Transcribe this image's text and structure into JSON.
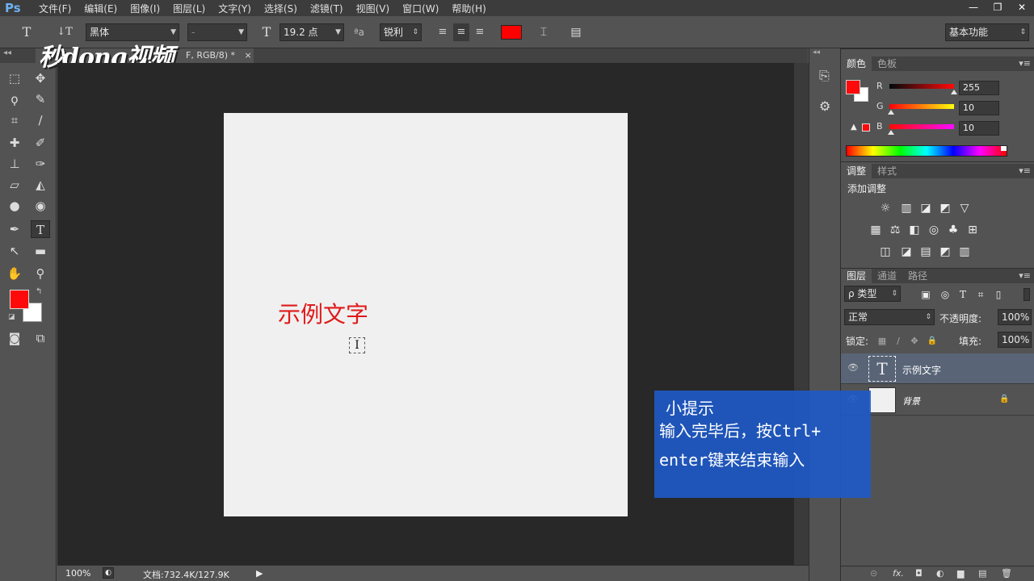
{
  "menubar": {
    "logo": "Ps",
    "items": [
      "文件(F)",
      "编辑(E)",
      "图像(I)",
      "图层(L)",
      "文字(Y)",
      "选择(S)",
      "滤镜(T)",
      "视图(V)",
      "窗口(W)",
      "帮助(H)"
    ],
    "window_controls": [
      "—",
      "❐",
      "✕"
    ]
  },
  "options": {
    "tool_icon": "T",
    "orient_icon": "↓T",
    "font_family": "黑体",
    "font_style": "-",
    "size_icon": "T",
    "font_size": "19.2 点",
    "aa_label": "ªa",
    "antialias": "锐利",
    "text_color": "#ff0000",
    "workspace": "基本功能"
  },
  "tab": {
    "title": "F, RGB/8) *",
    "close": "×"
  },
  "watermark": "秒dong视频",
  "canvas": {
    "sample_text": "示例文字",
    "cursor_glyph": "I",
    "text_color": "#e01919"
  },
  "status": {
    "zoom": "100%",
    "doc_info": "文档:732.4K/127.9K",
    "arrow": "▶"
  },
  "color_panel": {
    "tabs": [
      "颜色",
      "色板"
    ],
    "fg_color": "#ff0a0a",
    "bg_color": "#ffffff",
    "channels": [
      {
        "label": "R",
        "value": "255"
      },
      {
        "label": "G",
        "value": "10"
      },
      {
        "label": "B",
        "value": "10"
      }
    ],
    "warning_icon": "▲"
  },
  "adjust_panel": {
    "tabs": [
      "调整",
      "样式"
    ],
    "heading": "添加调整",
    "row1": [
      "☼",
      "▥",
      "◪",
      "◩",
      "▽"
    ],
    "row2": [
      "▦",
      "⚖",
      "◧",
      "◎",
      "♣",
      "⊞"
    ],
    "row3": [
      "◫",
      "◪",
      "▤",
      "◩",
      "▥"
    ]
  },
  "layers_panel": {
    "tabs": [
      "图层",
      "通道",
      "路径"
    ],
    "filter_kind": "ρ 类型",
    "filter_icons": [
      "▣",
      "◎",
      "T",
      "⌗",
      "▯"
    ],
    "blend_mode": "正常",
    "opacity_label": "不透明度:",
    "opacity": "100%",
    "lock_label": "锁定:",
    "lock_icons": [
      "▦",
      "∕",
      "✥",
      "🔒"
    ],
    "fill_label": "填充:",
    "fill": "100%",
    "layers": [
      {
        "name": "示例文字",
        "thumb": "T",
        "selected": true
      },
      {
        "name": "背景",
        "thumb": "",
        "selected": false,
        "lock": "🔒"
      }
    ],
    "footer_icons": [
      "⊝",
      "fx.",
      "◘",
      "◐",
      "▆",
      "▤",
      "🗑"
    ]
  },
  "tip": {
    "title": "小提示",
    "line1": "输入完毕后，按Ctrl+",
    "line2": "enter键来结束输入"
  }
}
